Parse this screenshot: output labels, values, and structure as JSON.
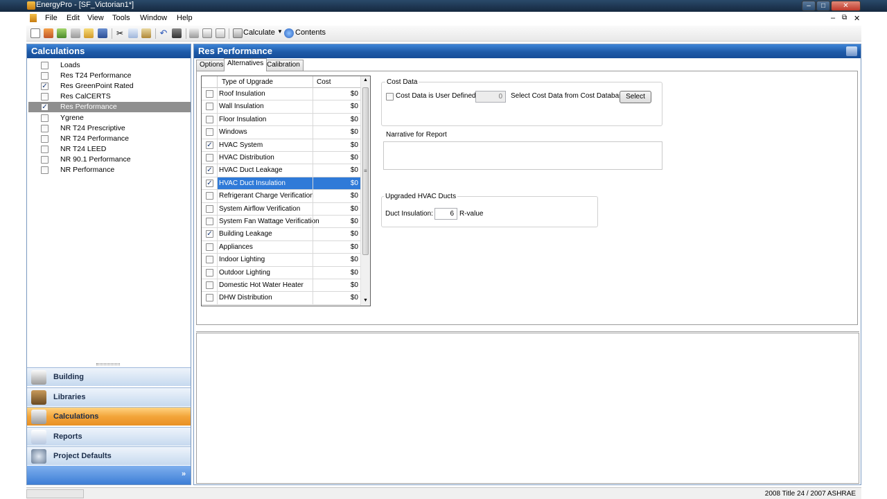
{
  "window": {
    "title": "EnergyPro - [SF_Victorian1*]"
  },
  "menu": [
    "File",
    "Edit",
    "View",
    "Tools",
    "Window",
    "Help"
  ],
  "toolbar": {
    "calculate": "Calculate",
    "contents": "Contents"
  },
  "left": {
    "header": "Calculations",
    "items": [
      {
        "label": "Loads",
        "checked": false
      },
      {
        "label": "Res T24 Performance",
        "checked": false
      },
      {
        "label": "Res GreenPoint Rated",
        "checked": true
      },
      {
        "label": "Res CalCERTS",
        "checked": false
      },
      {
        "label": "Res Performance",
        "checked": true,
        "selected": true
      },
      {
        "label": "Ygrene",
        "checked": false
      },
      {
        "label": "NR T24 Prescriptive",
        "checked": false
      },
      {
        "label": "NR T24 Performance",
        "checked": false
      },
      {
        "label": "NR T24 LEED",
        "checked": false
      },
      {
        "label": "NR 90.1 Performance",
        "checked": false
      },
      {
        "label": "NR Performance",
        "checked": false
      }
    ],
    "nav": [
      "Building",
      "Libraries",
      "Calculations",
      "Reports",
      "Project Defaults"
    ]
  },
  "right": {
    "header": "Res Performance",
    "tabs": [
      "Options",
      "Alternatives",
      "Calibration"
    ],
    "table": {
      "headers": [
        "Type of Upgrade",
        "Cost"
      ],
      "rows": [
        {
          "label": "Roof Insulation",
          "cost": "$0",
          "checked": false
        },
        {
          "label": "Wall Insulation",
          "cost": "$0",
          "checked": false
        },
        {
          "label": "Floor Insulation",
          "cost": "$0",
          "checked": false
        },
        {
          "label": "Windows",
          "cost": "$0",
          "checked": false
        },
        {
          "label": "HVAC System",
          "cost": "$0",
          "checked": true
        },
        {
          "label": "HVAC Distribution",
          "cost": "$0",
          "checked": false
        },
        {
          "label": "HVAC Duct Leakage",
          "cost": "$0",
          "checked": true
        },
        {
          "label": "HVAC Duct Insulation",
          "cost": "$0",
          "checked": true,
          "selected": true
        },
        {
          "label": "Refrigerant Charge Verification",
          "cost": "$0",
          "checked": false
        },
        {
          "label": "System Airflow Verification",
          "cost": "$0",
          "checked": false
        },
        {
          "label": "System Fan Wattage Verification",
          "cost": "$0",
          "checked": false
        },
        {
          "label": "Building Leakage",
          "cost": "$0",
          "checked": true
        },
        {
          "label": "Appliances",
          "cost": "$0",
          "checked": false
        },
        {
          "label": "Indoor Lighting",
          "cost": "$0",
          "checked": false
        },
        {
          "label": "Outdoor Lighting",
          "cost": "$0",
          "checked": false
        },
        {
          "label": "Domestic Hot Water Heater",
          "cost": "$0",
          "checked": false
        },
        {
          "label": "DHW Distribution",
          "cost": "$0",
          "checked": false
        }
      ]
    },
    "cost_data": {
      "title": "Cost Data",
      "user_defined_label": "Cost Data is User Defined",
      "value": "0",
      "select_label": "Select Cost Data from Cost Database",
      "select_button": "Select"
    },
    "narrative": {
      "label": "Narrative for Report",
      "value": ""
    },
    "ducts": {
      "title": "Upgraded HVAC Ducts",
      "label": "Duct Insulation:",
      "value": "6",
      "unit": "R-value"
    }
  },
  "status": {
    "right": "2008 Title 24 / 2007 ASHRAE"
  }
}
